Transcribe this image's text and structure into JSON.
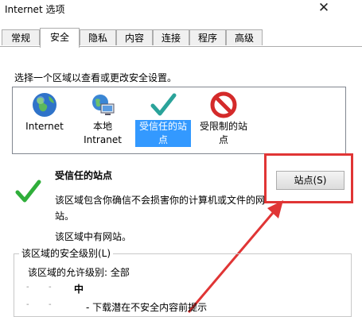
{
  "window": {
    "title": "Internet 选项",
    "close_glyph": "✕"
  },
  "tabs": [
    {
      "label": "常规"
    },
    {
      "label": "安全"
    },
    {
      "label": "隐私"
    },
    {
      "label": "内容"
    },
    {
      "label": "连接"
    },
    {
      "label": "程序"
    },
    {
      "label": "高级"
    }
  ],
  "active_tab": "安全",
  "security": {
    "instruction": "选择一个区域以查看或更改安全设置。",
    "zones": [
      {
        "label": "Internet",
        "icon": "globe-icon"
      },
      {
        "label": "本地\nIntranet",
        "icon": "intranet-icon"
      },
      {
        "label": "受信任的站\n点",
        "icon": "trusted-check-icon",
        "selected": true
      },
      {
        "label": "受限制的站\n点",
        "icon": "restricted-icon"
      }
    ],
    "zone_title": "受信任的站点",
    "zone_desc": "该区域包含你确信不会损害你的计算机或文件的网站。",
    "zone_desc2": "该区域中有网站。",
    "sites_button": "站点(S)",
    "group_label": "该区域的安全级别(L)",
    "allowed_level": "该区域的允许级别: 全部",
    "level": "中",
    "level_bullet": "- 下载潜在不安全内容前提示"
  },
  "colors": {
    "selection": "#3399ff",
    "annotation": "#e03535",
    "check": "#2aa39a"
  }
}
